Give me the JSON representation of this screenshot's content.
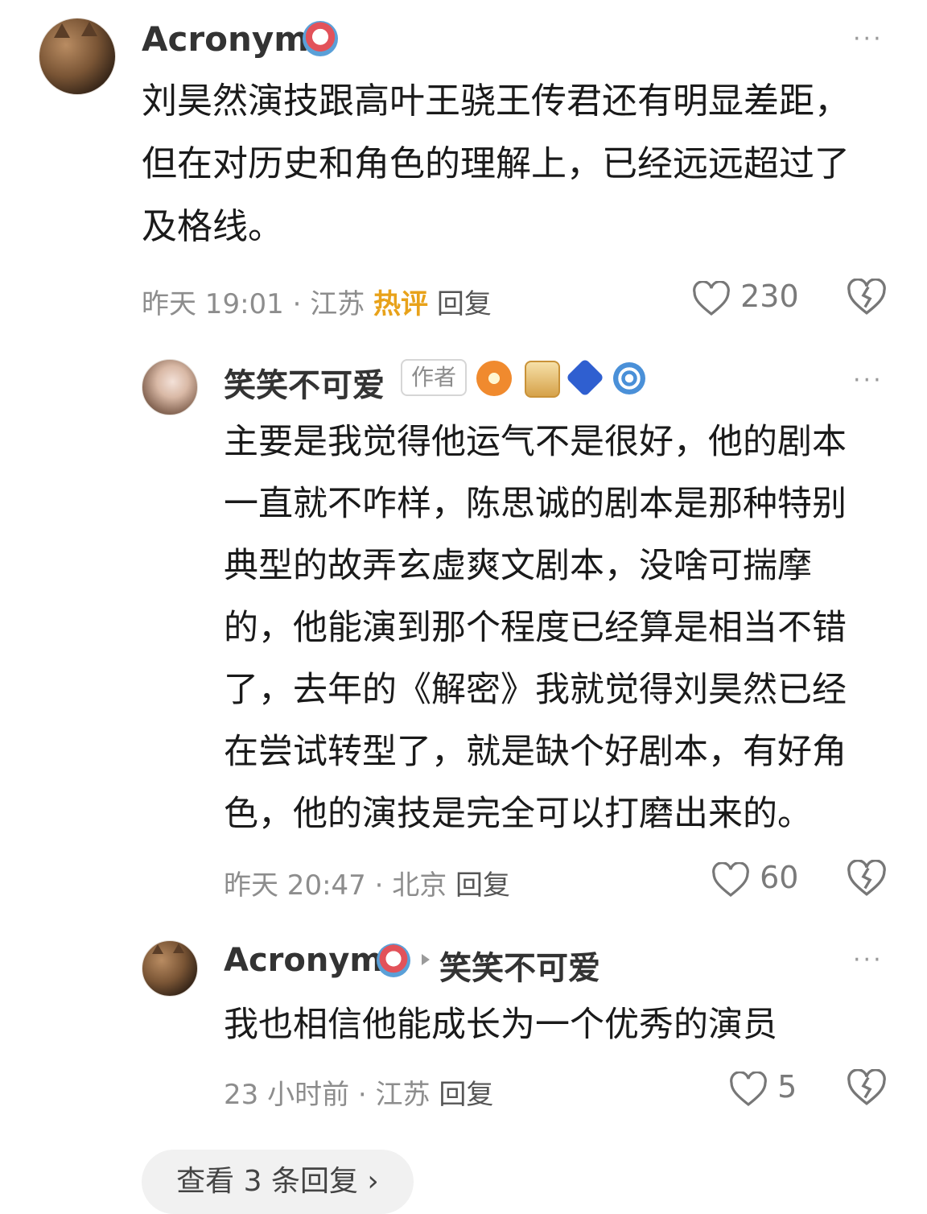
{
  "comments": [
    {
      "author": "Acronym",
      "content_lines": [
        "刘昊然演技跟高叶王骁王传君还有明显差距，",
        "但在对历史和角色的理解上，已经远远超过了",
        "及格线。"
      ],
      "time": "昨天 19:01",
      "location": "江苏",
      "hot_label": "热评",
      "reply_label": "回复",
      "likes": "230"
    }
  ],
  "replies": [
    {
      "author": "笑笑不可爱",
      "author_tag": "作者",
      "content_lines": [
        "主要是我觉得他运气不是很好，他的剧本",
        "一直就不咋样，陈思诚的剧本是那种特别",
        "典型的故弄玄虚爽文剧本，没啥可揣摩",
        "的，他能演到那个程度已经算是相当不错",
        "了，去年的《解密》我就觉得刘昊然已经",
        "在尝试转型了，就是缺个好剧本，有好角",
        "色，他的演技是完全可以打磨出来的。"
      ],
      "time": "昨天 20:47",
      "location": "北京",
      "reply_label": "回复",
      "likes": "60"
    },
    {
      "author": "Acronym",
      "reply_to": "笑笑不可爱",
      "content_lines": [
        "我也相信他能成长为一个优秀的演员"
      ],
      "time": "23 小时前",
      "location": "江苏",
      "reply_label": "回复",
      "likes": "5"
    }
  ],
  "separator": "·",
  "more_icon": "···",
  "view_more_label": "查看 3 条回复 ›",
  "colors": {
    "hot": "#e8a21a",
    "meta": "#8d8d8d",
    "text": "#1a1a1a"
  }
}
